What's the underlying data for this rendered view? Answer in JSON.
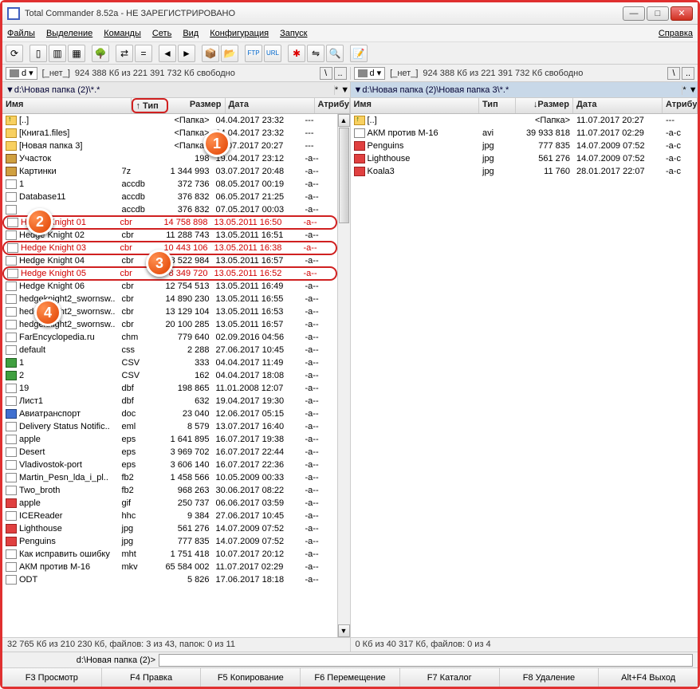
{
  "title": "Total Commander 8.52a - НЕ ЗАРЕГИСТРИРОВАНО",
  "menu": {
    "file": "Файлы",
    "mark": "Выделение",
    "commands": "Команды",
    "net": "Сеть",
    "view": "Вид",
    "config": "Конфигурация",
    "start": "Запуск",
    "help": "Справка"
  },
  "drive": {
    "left_label": "d",
    "right_label": "d",
    "none": "[_нет_]",
    "free_left": "924 388 Кб из 221 391 732 Кб свободно",
    "free_right": "924 388 Кб из 221 391 732 Кб свободно",
    "root": "\\",
    "up": ".."
  },
  "path": {
    "left": "▼d:\\Новая папка (2)\\*.*",
    "right": "▼d:\\Новая папка (2)\\Новая папка 3\\*.*",
    "star": "*  ▼"
  },
  "cols": {
    "name": "Имя",
    "ext": "↑ Тип",
    "size": "Размер",
    "date": "Дата",
    "attr": "Атрибу",
    "size_r": "↓Размер",
    "ext_r": "Тип"
  },
  "left_rows": [
    {
      "icon": "up",
      "name": "[..]",
      "ext": "",
      "size": "<Папка>",
      "date": "04.04.2017 23:32",
      "attr": "---",
      "sel": false
    },
    {
      "icon": "folder",
      "name": "[Книга1.files]",
      "ext": "",
      "size": "<Папка>",
      "date": "04.04.2017 23:32",
      "attr": "---",
      "sel": false
    },
    {
      "icon": "folder",
      "name": "[Новая папка 3]",
      "ext": "",
      "size": "<Папка>",
      "date": "11.07.2017 20:27",
      "attr": "---",
      "sel": false
    },
    {
      "icon": "arc",
      "name": "Участок",
      "ext": "",
      "size": "198",
      "date": "19.04.2017 23:12",
      "attr": "-a--",
      "sel": false
    },
    {
      "icon": "arc",
      "name": "Картинки",
      "ext": "7z",
      "size": "1 344 993",
      "date": "03.07.2017 20:48",
      "attr": "-a--",
      "sel": false
    },
    {
      "icon": "file",
      "name": "1",
      "ext": "accdb",
      "size": "372 736",
      "date": "08.05.2017 00:19",
      "attr": "-a--",
      "sel": false
    },
    {
      "icon": "file",
      "name": "Database11",
      "ext": "accdb",
      "size": "376 832",
      "date": "06.05.2017 21:25",
      "attr": "-a--",
      "sel": false
    },
    {
      "icon": "file",
      "name": "",
      "ext": "accdb",
      "size": "376 832",
      "date": "07.05.2017 00:03",
      "attr": "-a--",
      "sel": false
    },
    {
      "icon": "file",
      "name": "Hedge Knight 01",
      "ext": "cbr",
      "size": "14 758 898",
      "date": "13.05.2011 16:50",
      "attr": "-a--",
      "sel": true,
      "hl": true
    },
    {
      "icon": "file",
      "name": "Hedge Knight 02",
      "ext": "cbr",
      "size": "11 288 743",
      "date": "13.05.2011 16:51",
      "attr": "-a--",
      "sel": false
    },
    {
      "icon": "file",
      "name": "Hedge Knight 03",
      "ext": "cbr",
      "size": "10 443 106",
      "date": "13.05.2011 16:38",
      "attr": "-a--",
      "sel": true,
      "hl": true
    },
    {
      "icon": "file",
      "name": "Hedge Knight 04",
      "ext": "cbr",
      "size": "8 522 984",
      "date": "13.05.2011 16:57",
      "attr": "-a--",
      "sel": false
    },
    {
      "icon": "file",
      "name": "Hedge Knight 05",
      "ext": "cbr",
      "size": "8 349 720",
      "date": "13.05.2011 16:52",
      "attr": "-a--",
      "sel": true,
      "hl": true
    },
    {
      "icon": "file",
      "name": "Hedge Knight 06",
      "ext": "cbr",
      "size": "12 754 513",
      "date": "13.05.2011 16:49",
      "attr": "-a--",
      "sel": false
    },
    {
      "icon": "file",
      "name": "hedgeknight2_swornsw..",
      "ext": "cbr",
      "size": "14 890 230",
      "date": "13.05.2011 16:55",
      "attr": "-a--",
      "sel": false
    },
    {
      "icon": "file",
      "name": "hedgeknight2_swornsw..",
      "ext": "cbr",
      "size": "13 129 104",
      "date": "13.05.2011 16:53",
      "attr": "-a--",
      "sel": false
    },
    {
      "icon": "file",
      "name": "hedgeknight2_swornsw..",
      "ext": "cbr",
      "size": "20 100 285",
      "date": "13.05.2011 16:57",
      "attr": "-a--",
      "sel": false
    },
    {
      "icon": "file",
      "name": "FarEncyclopedia.ru",
      "ext": "chm",
      "size": "779 640",
      "date": "02.09.2016 04:56",
      "attr": "-a--",
      "sel": false
    },
    {
      "icon": "file",
      "name": "default",
      "ext": "css",
      "size": "2 288",
      "date": "27.06.2017 10:45",
      "attr": "-a--",
      "sel": false
    },
    {
      "icon": "xls",
      "name": "1",
      "ext": "CSV",
      "size": "333",
      "date": "04.04.2017 11:49",
      "attr": "-a--",
      "sel": false
    },
    {
      "icon": "xls",
      "name": "2",
      "ext": "CSV",
      "size": "162",
      "date": "04.04.2017 18:08",
      "attr": "-a--",
      "sel": false
    },
    {
      "icon": "file",
      "name": "19",
      "ext": "dbf",
      "size": "198 865",
      "date": "11.01.2008 12:07",
      "attr": "-a--",
      "sel": false
    },
    {
      "icon": "file",
      "name": "Лист1",
      "ext": "dbf",
      "size": "632",
      "date": "19.04.2017 19:30",
      "attr": "-a--",
      "sel": false
    },
    {
      "icon": "doc",
      "name": "Авиатранспорт",
      "ext": "doc",
      "size": "23 040",
      "date": "12.06.2017 05:15",
      "attr": "-a--",
      "sel": false
    },
    {
      "icon": "file",
      "name": "Delivery Status Notific..",
      "ext": "eml",
      "size": "8 579",
      "date": "13.07.2017 16:40",
      "attr": "-a--",
      "sel": false
    },
    {
      "icon": "file",
      "name": "apple",
      "ext": "eps",
      "size": "1 641 895",
      "date": "16.07.2017 19:38",
      "attr": "-a--",
      "sel": false
    },
    {
      "icon": "file",
      "name": "Desert",
      "ext": "eps",
      "size": "3 969 702",
      "date": "16.07.2017 22:44",
      "attr": "-a--",
      "sel": false
    },
    {
      "icon": "file",
      "name": "Vladivostok-port",
      "ext": "eps",
      "size": "3 606 140",
      "date": "16.07.2017 22:36",
      "attr": "-a--",
      "sel": false
    },
    {
      "icon": "file",
      "name": "Martin_Pesn_lda_i_pl..",
      "ext": "fb2",
      "size": "1 458 566",
      "date": "10.05.2009 00:33",
      "attr": "-a--",
      "sel": false
    },
    {
      "icon": "file",
      "name": "Two_broth",
      "ext": "fb2",
      "size": "968 263",
      "date": "30.06.2017 08:22",
      "attr": "-a--",
      "sel": false
    },
    {
      "icon": "img",
      "name": "apple",
      "ext": "gif",
      "size": "250 737",
      "date": "06.06.2017 03:59",
      "attr": "-a--",
      "sel": false
    },
    {
      "icon": "file",
      "name": "ICEReader",
      "ext": "hhc",
      "size": "9 384",
      "date": "27.06.2017 10:45",
      "attr": "-a--",
      "sel": false
    },
    {
      "icon": "img",
      "name": "Lighthouse",
      "ext": "jpg",
      "size": "561 276",
      "date": "14.07.2009 07:52",
      "attr": "-a--",
      "sel": false
    },
    {
      "icon": "img",
      "name": "Penguins",
      "ext": "jpg",
      "size": "777 835",
      "date": "14.07.2009 07:52",
      "attr": "-a--",
      "sel": false
    },
    {
      "icon": "file",
      "name": "Как исправить ошибку",
      "ext": "mht",
      "size": "1 751 418",
      "date": "10.07.2017 20:12",
      "attr": "-a--",
      "sel": false
    },
    {
      "icon": "file",
      "name": "АКМ против М-16",
      "ext": "mkv",
      "size": "65 584 002",
      "date": "11.07.2017 02:29",
      "attr": "-a--",
      "sel": false
    },
    {
      "icon": "file",
      "name": "ODT",
      "ext": "",
      "size": "5 826",
      "date": "17.06.2017 18:18",
      "attr": "-a--",
      "sel": false
    }
  ],
  "right_rows": [
    {
      "icon": "up",
      "name": "[..]",
      "ext": "",
      "size": "<Папка>",
      "date": "11.07.2017 20:27",
      "attr": "---"
    },
    {
      "icon": "file",
      "name": "АКМ против М-16",
      "ext": "avi",
      "size": "39 933 818",
      "date": "11.07.2017 02:29",
      "attr": "-a-c"
    },
    {
      "icon": "img",
      "name": "Penguins",
      "ext": "jpg",
      "size": "777 835",
      "date": "14.07.2009 07:52",
      "attr": "-a-c"
    },
    {
      "icon": "img",
      "name": "Lighthouse",
      "ext": "jpg",
      "size": "561 276",
      "date": "14.07.2009 07:52",
      "attr": "-a-c"
    },
    {
      "icon": "img",
      "name": "Koala3",
      "ext": "jpg",
      "size": "11 760",
      "date": "28.01.2017 22:07",
      "attr": "-a-c"
    }
  ],
  "status": {
    "left": "32 765 Кб из 210 230 Кб, файлов: 3 из 43, папок: 0 из 11",
    "right": "0 Кб из 40 317 Кб, файлов: 0 из 4"
  },
  "cmd": {
    "prompt": "d:\\Новая папка (2)>"
  },
  "fn": {
    "f3": "F3 Просмотр",
    "f4": "F4 Правка",
    "f5": "F5 Копирование",
    "f6": "F6 Перемещение",
    "f7": "F7 Каталог",
    "f8": "F8 Удаление",
    "alt": "Alt+F4 Выход"
  },
  "badges": {
    "b1": "1",
    "b2": "2",
    "b3": "3",
    "b4": "4"
  }
}
